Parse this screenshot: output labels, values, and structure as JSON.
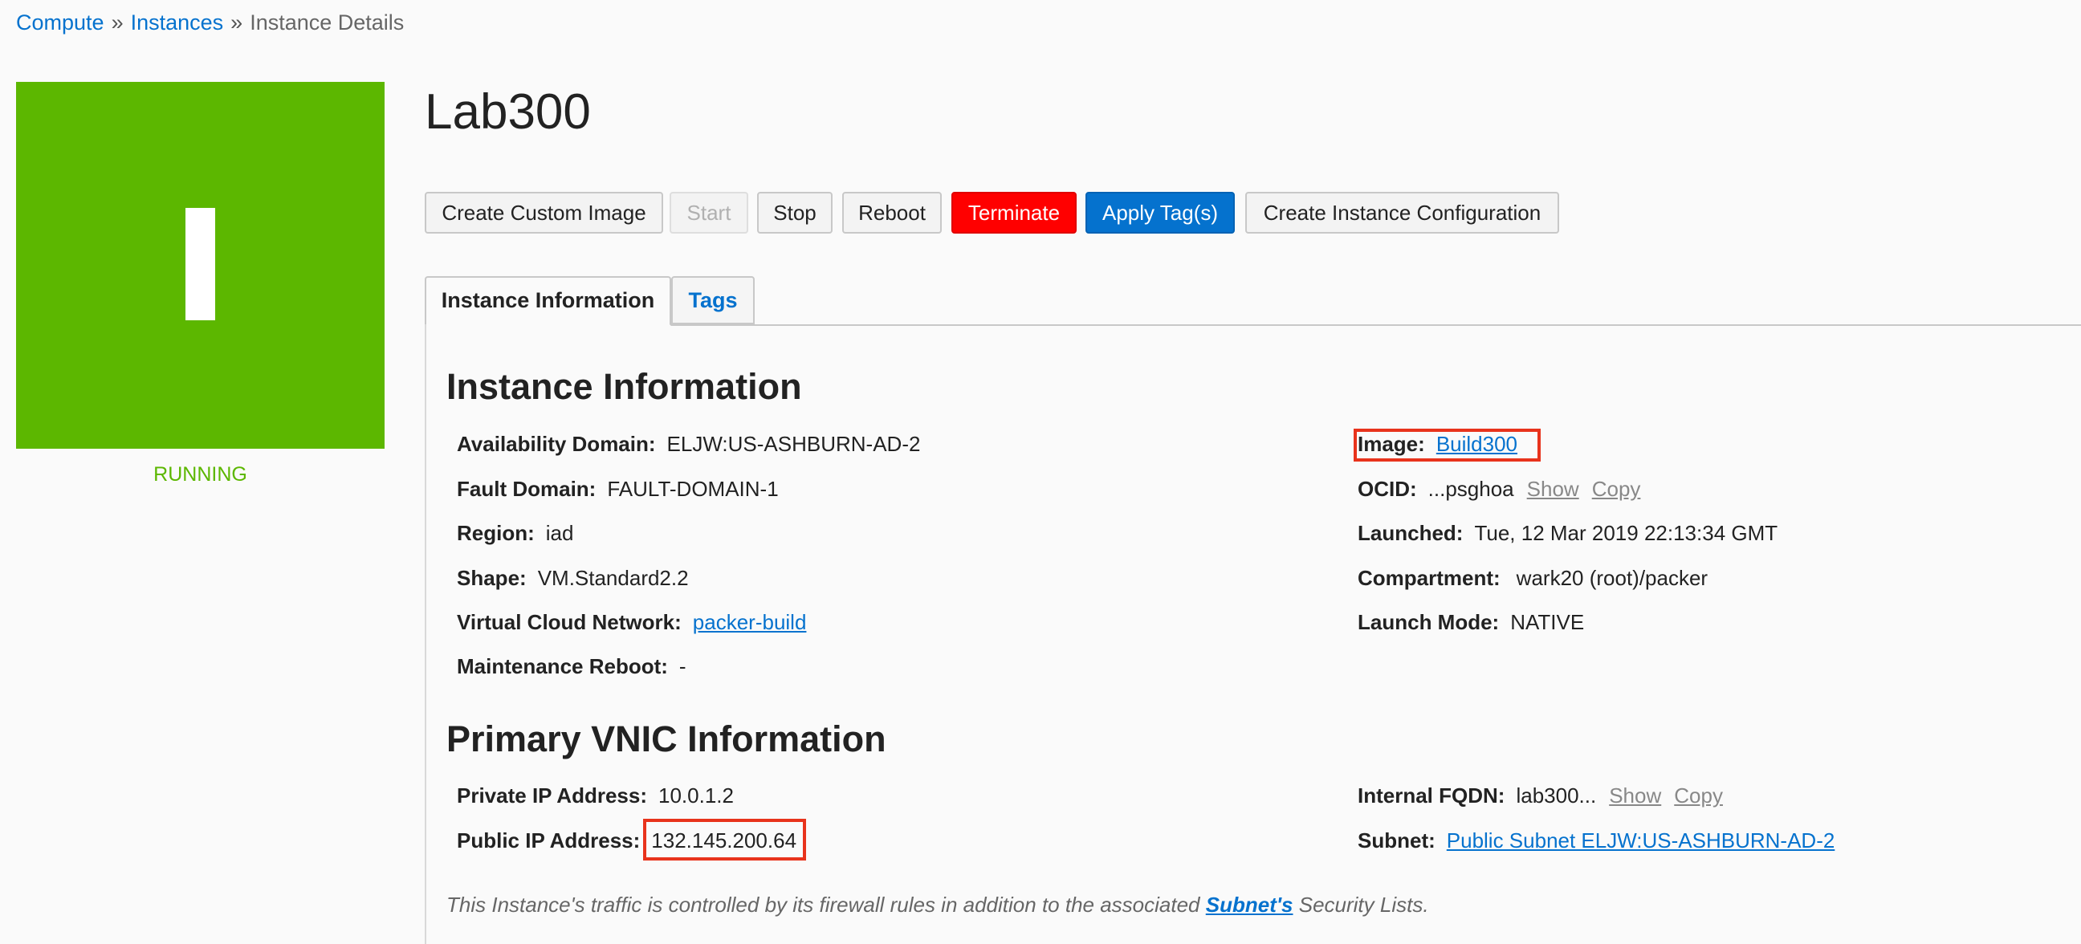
{
  "breadcrumb": {
    "compute": "Compute",
    "instances": "Instances",
    "current": "Instance Details",
    "separator": "»"
  },
  "status": {
    "tile_letter": "I",
    "label": "RUNNING",
    "color": "#5cb700"
  },
  "title": "Lab300",
  "toolbar": {
    "create_custom_image": "Create Custom Image",
    "start": "Start",
    "stop": "Stop",
    "reboot": "Reboot",
    "terminate": "Terminate",
    "apply_tags": "Apply Tag(s)",
    "create_instance_configuration": "Create Instance Configuration"
  },
  "tabs": {
    "instance_information": "Instance Information",
    "tags": "Tags"
  },
  "instance_info": {
    "heading": "Instance Information",
    "availability_domain": {
      "label": "Availability Domain:",
      "value": "ELJW:US-ASHBURN-AD-2"
    },
    "fault_domain": {
      "label": "Fault Domain:",
      "value": "FAULT-DOMAIN-1"
    },
    "region": {
      "label": "Region:",
      "value": "iad"
    },
    "shape": {
      "label": "Shape:",
      "value": "VM.Standard2.2"
    },
    "vcn": {
      "label": "Virtual Cloud Network:",
      "value": "packer-build"
    },
    "maintenance_reboot": {
      "label": "Maintenance Reboot:",
      "value": "-"
    },
    "image": {
      "label": "Image:",
      "value": "Build300"
    },
    "ocid": {
      "label": "OCID:",
      "value": "...psghoa",
      "show": "Show",
      "copy": "Copy"
    },
    "launched": {
      "label": "Launched:",
      "value": "Tue, 12 Mar 2019 22:13:34 GMT"
    },
    "compartment": {
      "label": "Compartment:",
      "value": "wark20 (root)/packer"
    },
    "launch_mode": {
      "label": "Launch Mode:",
      "value": "NATIVE"
    }
  },
  "vnic_info": {
    "heading": "Primary VNIC Information",
    "private_ip": {
      "label": "Private IP Address:",
      "value": "10.0.1.2"
    },
    "public_ip": {
      "label": "Public IP Address:",
      "value": "132.145.200.64"
    },
    "internal_fqdn": {
      "label": "Internal FQDN:",
      "value": "lab300...",
      "show": "Show",
      "copy": "Copy"
    },
    "subnet": {
      "label": "Subnet:",
      "value": "Public Subnet ELJW:US-ASHBURN-AD-2"
    }
  },
  "footnote": {
    "before": "This Instance's traffic is controlled by its firewall rules in addition to the associated ",
    "link": "Subnet's",
    "after": " Security Lists."
  },
  "colors": {
    "link": "#0572ce",
    "terminate": "#ff0000",
    "primary": "#0572ce",
    "highlight": "#e8331c"
  }
}
